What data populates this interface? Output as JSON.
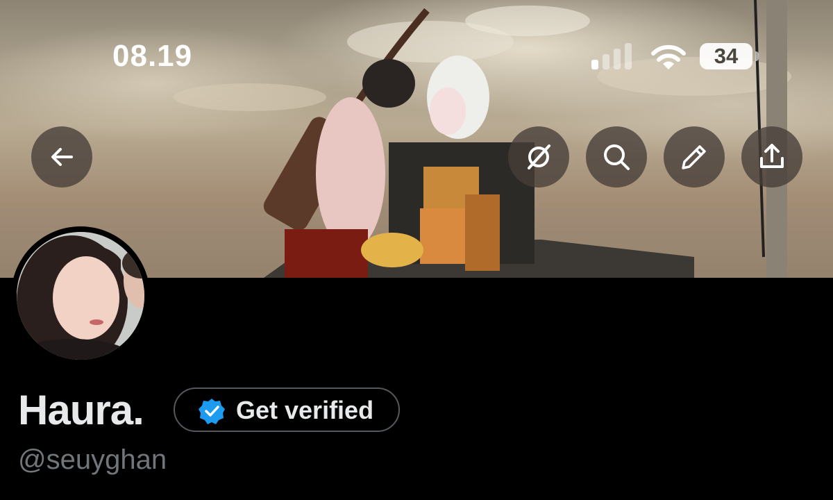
{
  "status_bar": {
    "time": "08.19",
    "battery_level": "34",
    "icons": [
      "signal-icon",
      "wifi-icon",
      "battery-icon"
    ]
  },
  "header": {
    "buttons": [
      {
        "name": "back-button",
        "icon": "arrow-left-icon"
      },
      {
        "name": "grok-button",
        "icon": "grok-icon"
      },
      {
        "name": "search-button",
        "icon": "search-icon"
      },
      {
        "name": "compose-button",
        "icon": "pencil-icon"
      },
      {
        "name": "share-button",
        "icon": "share-icon"
      }
    ]
  },
  "profile": {
    "display_name": "Haura.",
    "handle": "@seuyghan",
    "verify_button_label": "Get verified"
  },
  "colors": {
    "background": "#000000",
    "primary_text": "#e7e9ea",
    "secondary_text": "#71767b",
    "verified_blue": "#1d9bf0",
    "button_border": "#55595e"
  }
}
